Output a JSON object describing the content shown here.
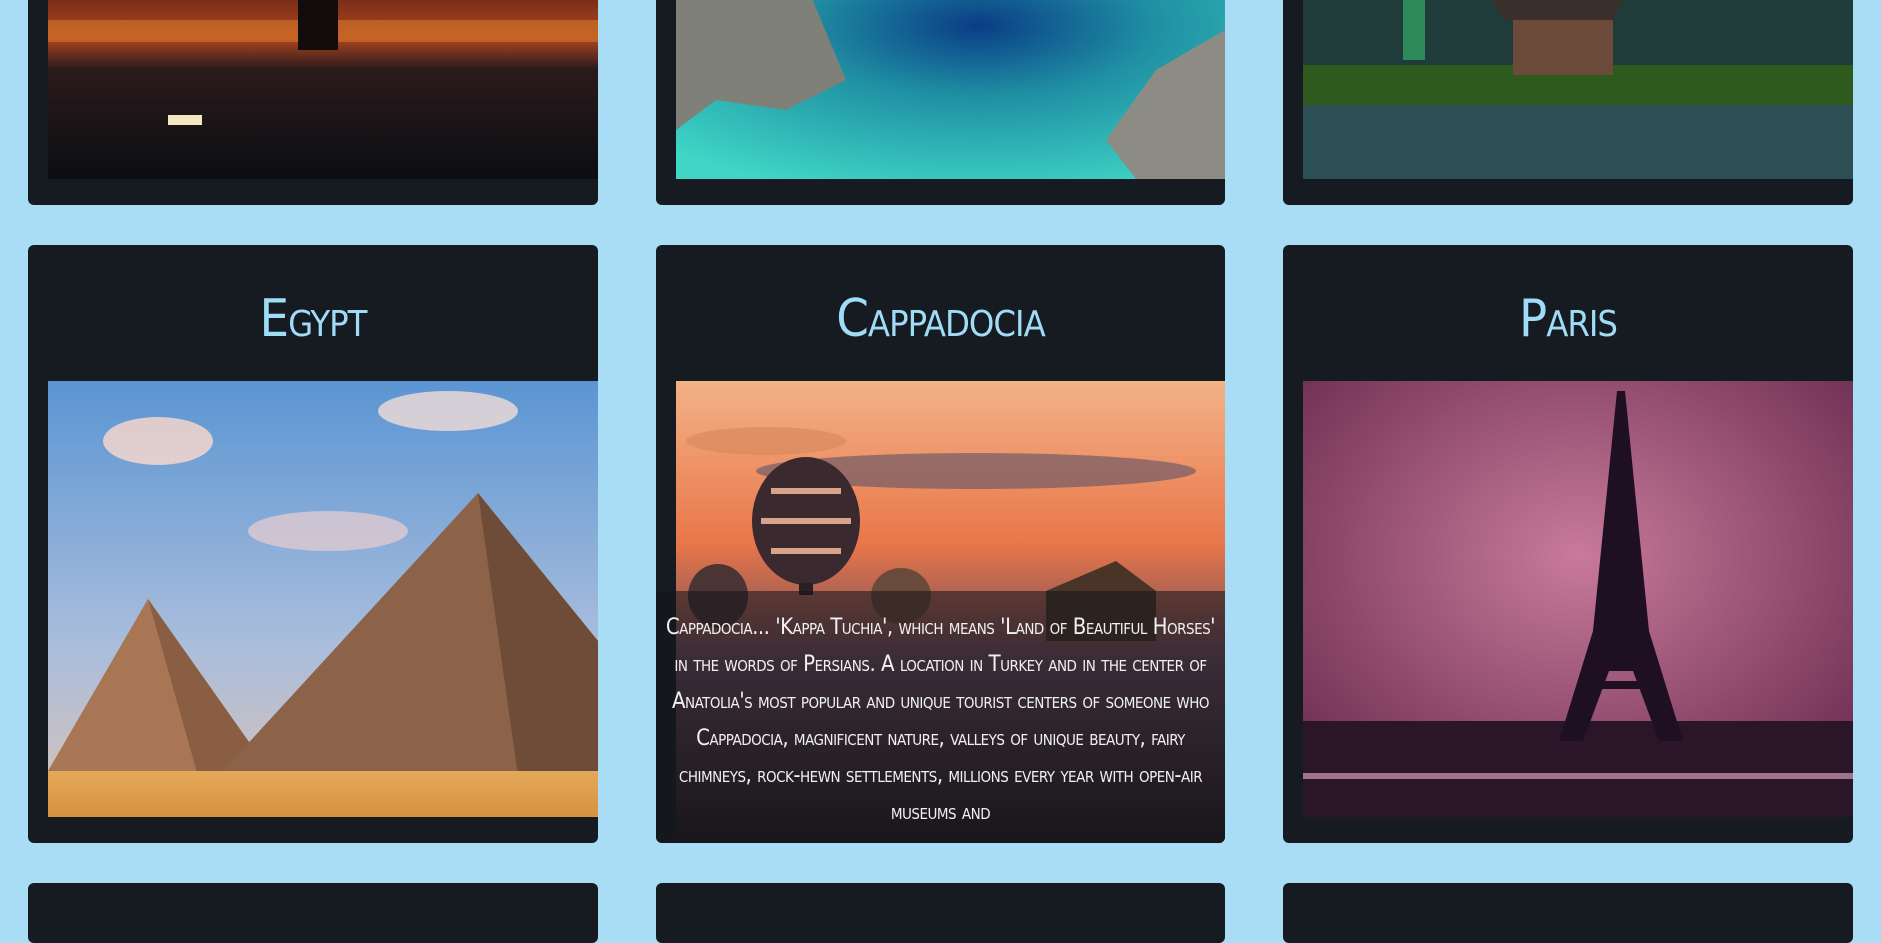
{
  "cards": [
    {
      "title": "",
      "image": "new-york-night-bridge"
    },
    {
      "title": "",
      "image": "turquoise-lagoon-rocks"
    },
    {
      "title": "",
      "image": "bali-water-temple"
    },
    {
      "title": "Egypt",
      "image": "pyramids"
    },
    {
      "title": "Cappadocia",
      "image": "hot-air-balloons",
      "description": "Cappadocia... 'Kappa Tuchia', which means 'Land of Beautiful Horses' in the words of Persians. A location in Turkey and in the center of Anatolia's most popular and unique tourist centers of someone who Cappadocia, magnificent nature, valleys of unique beauty, fairy chimneys, rock-hewn settlements, millions every year with open-air museums and"
    },
    {
      "title": "Paris",
      "image": "eiffel-tower-night"
    }
  ],
  "colors": {
    "background": "#a9ddf5",
    "card": "#161b21",
    "title": "#9fdcf5"
  }
}
